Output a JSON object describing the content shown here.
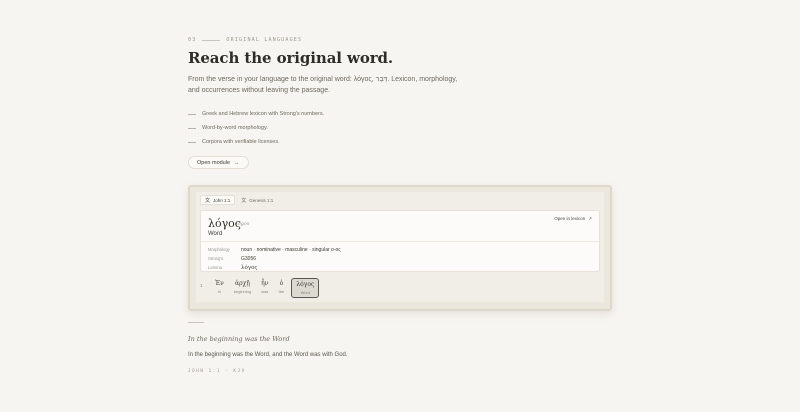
{
  "section": {
    "number": "03",
    "eyebrow": "Original languages",
    "title": "Reach the original word.",
    "lede": "From the verse in your language to the original word: λόγος, דָּבָר. Lexicon, morphology, and occurrences without leaving the passage.",
    "bullets": [
      "Greek and Hebrew lexicon with Strong's numbers.",
      "Word-by-word morphology.",
      "Corpora with verifiable licenses."
    ],
    "cta_label": "Open module",
    "cta_icon": "arrow-right-icon"
  },
  "module": {
    "tabs": [
      {
        "label": "John 1:1",
        "icon": "translate-icon"
      },
      {
        "label": "Genesis 1:1",
        "icon": "translate-icon"
      }
    ],
    "active_tab": 0,
    "lemma": {
      "greek": "λόγος",
      "translit": "lógos",
      "gloss": "Word",
      "open_label": "Open in lexicon",
      "open_icon": "arrow-up-right-icon"
    },
    "props": [
      {
        "key": "Morphology",
        "value": "noun · nominative · masculine · singular ο-ος"
      },
      {
        "key": "Strong's",
        "value": "G3056"
      },
      {
        "key": "Lemma",
        "value": "λόγος"
      }
    ],
    "verse_number": "1",
    "tokens": [
      {
        "greek": "Ἐν",
        "english": "In"
      },
      {
        "greek": "ἀρχῇ",
        "english": "beginning"
      },
      {
        "greek": "ἦν",
        "english": "was"
      },
      {
        "greek": "ὁ",
        "english": "the"
      },
      {
        "greek": "λόγος",
        "english": "Word"
      }
    ],
    "selected_token": 4
  },
  "quote": {
    "title": "In the beginning was the Word",
    "text": "In the beginning was the Word, and the Word was with God.",
    "reference": "John 1:1 · KJV"
  },
  "colors": {
    "background": "#f7f5f1",
    "frame": "#ebe7dc",
    "card": "#fcfbf9",
    "text": "#2f2d28"
  }
}
